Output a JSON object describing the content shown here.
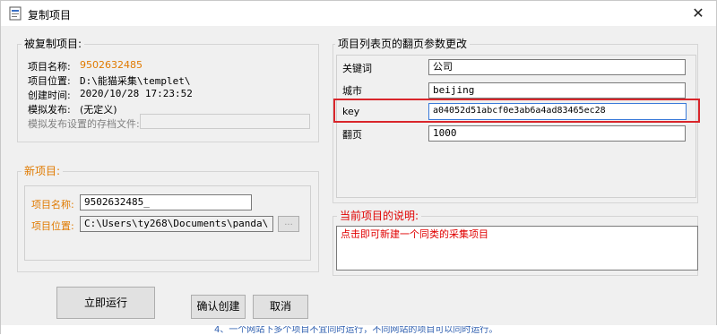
{
  "window": {
    "title": "复制项目",
    "close_glyph": "✕"
  },
  "source_project": {
    "legend": "被复制项目:",
    "name_label": "项目名称:",
    "name_value": "9502632485",
    "location_label": "项目位置:",
    "location_value": "D:\\能猫采集\\templet\\",
    "created_label": "创建时间:",
    "created_value": "2020/10/28 17:23:52",
    "publish_label": "模拟发布:",
    "publish_value": "(无定义)",
    "publish_file_label": "模拟发布设置的存档文件:",
    "publish_file_value": ""
  },
  "new_project": {
    "legend": "新项目:",
    "name_label": "项目名称:",
    "name_value": "9502632485_",
    "location_label": "项目位置:",
    "location_value": "C:\\Users\\ty268\\Documents\\panda\\",
    "browse_label": "..."
  },
  "paging_params": {
    "legend": "项目列表页的翻页参数更改",
    "rows": [
      {
        "label": "关键词",
        "value": "公司"
      },
      {
        "label": "城市",
        "value": "beijing"
      },
      {
        "label": "key",
        "value": "a04052d51abcf0e3ab6a4ad83465ec28"
      },
      {
        "label": "翻页",
        "value": "1000"
      }
    ]
  },
  "description": {
    "legend": "当前项目的说明:",
    "text": "点击即可新建一个同类的采集项目"
  },
  "buttons": {
    "run_now": "立即运行",
    "confirm": "确认创建",
    "cancel": "取消"
  },
  "background_text": "4、一个网站下多个项目不宜同时运行，不同网站的项目可以同时运行。",
  "colors": {
    "accent_orange": "#e07a00",
    "highlight_red": "#d9262b",
    "description_red": "#e00000"
  },
  "icons": {
    "app": "app-window-icon",
    "close": "close-icon"
  }
}
